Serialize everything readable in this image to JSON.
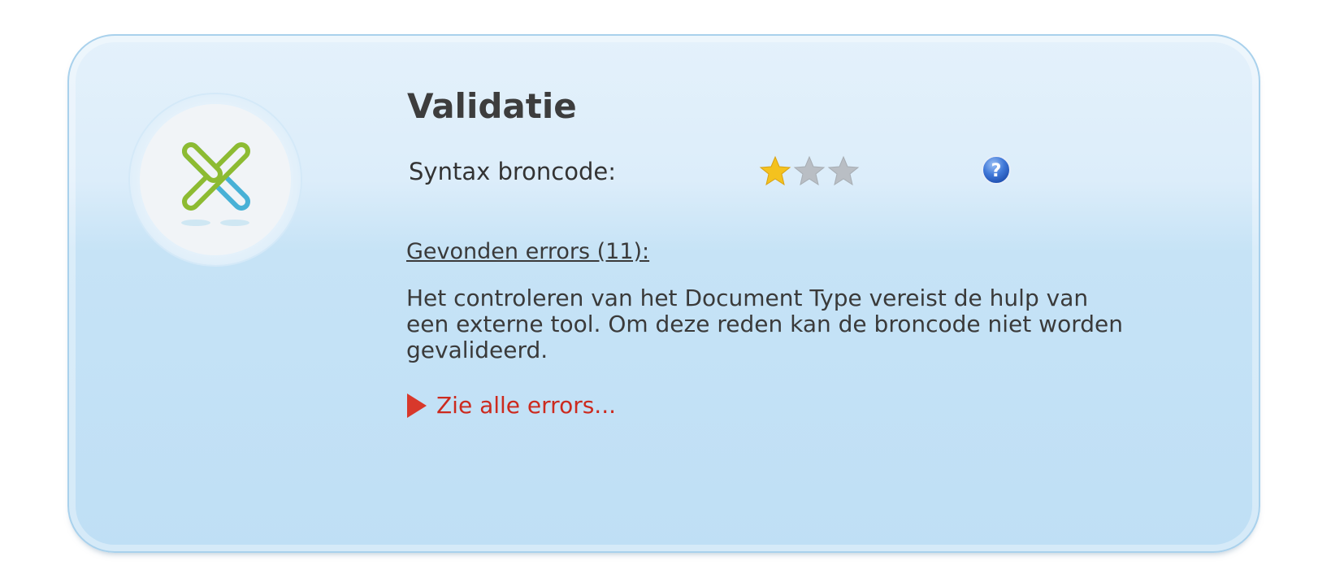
{
  "panel": {
    "title": "Validatie",
    "syntax": {
      "label": "Syntax broncode:",
      "rating": 1,
      "max_rating": 3,
      "icon": "star-icon"
    },
    "help_icon": "question-icon",
    "errors": {
      "heading": "Gevonden errors (11):",
      "message": "Het controleren van het Document Type vereist de hulp van een externe tool. Om deze reden kan de broncode niet worden gevalideerd.",
      "see_all_label": "Zie alle errors..."
    },
    "badge_icon": "x-cross-icon"
  },
  "colors": {
    "star_filled": "#f4c21e",
    "star_empty": "#b9bec4",
    "link_red": "#cc2a1e",
    "cross_green": "#8dbb32",
    "cross_blue": "#48b1d6"
  }
}
